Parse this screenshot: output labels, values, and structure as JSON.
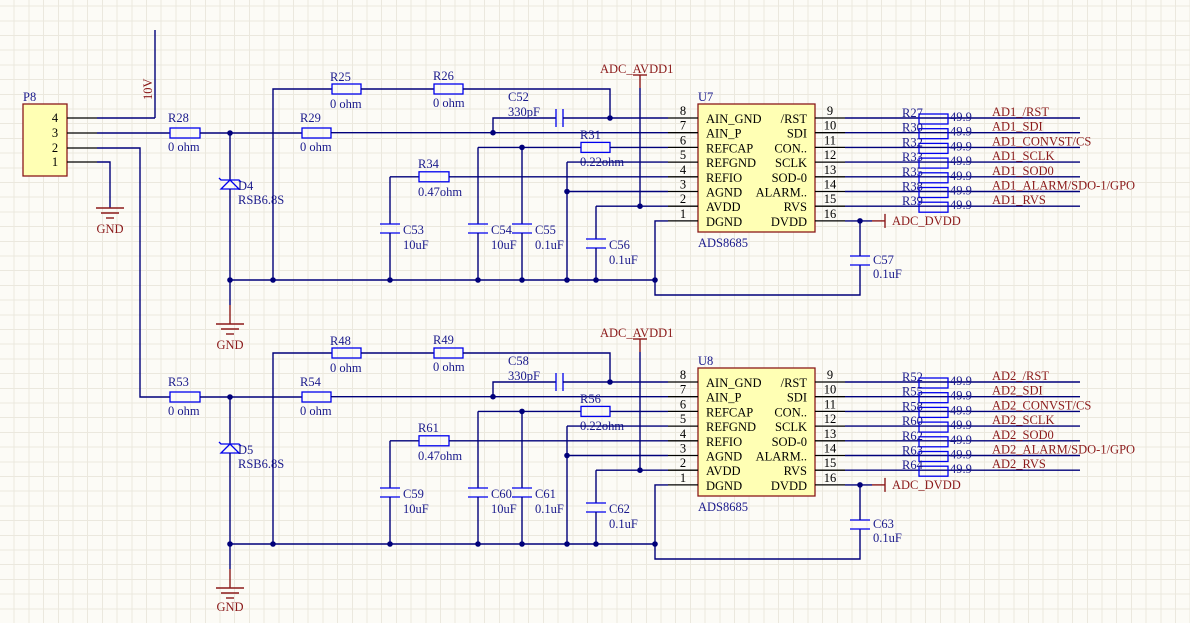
{
  "connector": {
    "ref": "P8",
    "pins": [
      "4",
      "3",
      "2",
      "1"
    ]
  },
  "power": {
    "v10": "10V",
    "gnd": "GND",
    "avdd": "ADC_AVDD1",
    "dvdd": "ADC_DVDD"
  },
  "colors": {
    "wire": "#00007a",
    "component": "#0000ee",
    "net_label": "#8b1a1a",
    "chip_fill": "#ffffb4"
  },
  "channels": [
    {
      "chip": {
        "ref": "U7",
        "part": "ADS8685",
        "left_pins": [
          {
            "num": "8",
            "name": "AIN_GND"
          },
          {
            "num": "7",
            "name": "AIN_P"
          },
          {
            "num": "6",
            "name": "REFCAP"
          },
          {
            "num": "5",
            "name": "REFGND"
          },
          {
            "num": "4",
            "name": "REFIO"
          },
          {
            "num": "3",
            "name": "AGND"
          },
          {
            "num": "2",
            "name": "AVDD"
          },
          {
            "num": "1",
            "name": "DGND"
          }
        ],
        "right_pins": [
          {
            "num": "9",
            "name": "/RST"
          },
          {
            "num": "10",
            "name": "SDI"
          },
          {
            "num": "11",
            "name": "CON.."
          },
          {
            "num": "12",
            "name": "SCLK"
          },
          {
            "num": "13",
            "name": "SOD-0"
          },
          {
            "num": "14",
            "name": "ALARM.."
          },
          {
            "num": "15",
            "name": "RVS"
          },
          {
            "num": "16",
            "name": "DVDD"
          }
        ]
      },
      "r_in": {
        "ref": "R28",
        "value": "0 ohm"
      },
      "diode": {
        "ref": "D4",
        "value": "RSB6.8S"
      },
      "r_loop1": {
        "ref": "R25",
        "value": "0 ohm"
      },
      "r_loop2": {
        "ref": "R26",
        "value": "0 ohm"
      },
      "r_sig": {
        "ref": "R29",
        "value": "0 ohm"
      },
      "c_in": {
        "ref": "C52",
        "value": "330pF"
      },
      "r_refcap": {
        "ref": "R31",
        "value": "0.22ohm"
      },
      "r_refio": {
        "ref": "R34",
        "value": "0.47ohm"
      },
      "c_refio": {
        "ref": "C53",
        "value": "10uF"
      },
      "c_refcap1": {
        "ref": "C54",
        "value": "10uF"
      },
      "c_refcap2": {
        "ref": "C55",
        "value": "0.1uF"
      },
      "c_avdd": {
        "ref": "C56",
        "value": "0.1uF"
      },
      "c_dvdd": {
        "ref": "C57",
        "value": "0.1uF"
      },
      "series": [
        {
          "ref": "R27",
          "value": "49.9",
          "net": "AD1_/RST"
        },
        {
          "ref": "R30",
          "value": "49.9",
          "net": "AD1_SDI"
        },
        {
          "ref": "R32",
          "value": "49.9",
          "net": "AD1_CONVST/CS"
        },
        {
          "ref": "R33",
          "value": "49.9",
          "net": "AD1_SCLK"
        },
        {
          "ref": "R35",
          "value": "49.9",
          "net": "AD1_SOD0"
        },
        {
          "ref": "R38",
          "value": "49.9",
          "net": "AD1_ALARM/SDO-1/GPO"
        },
        {
          "ref": "R39",
          "value": "49.9",
          "net": "AD1_RVS"
        }
      ]
    },
    {
      "chip": {
        "ref": "U8",
        "part": "ADS8685",
        "left_pins": [
          {
            "num": "8",
            "name": "AIN_GND"
          },
          {
            "num": "7",
            "name": "AIN_P"
          },
          {
            "num": "6",
            "name": "REFCAP"
          },
          {
            "num": "5",
            "name": "REFGND"
          },
          {
            "num": "4",
            "name": "REFIO"
          },
          {
            "num": "3",
            "name": "AGND"
          },
          {
            "num": "2",
            "name": "AVDD"
          },
          {
            "num": "1",
            "name": "DGND"
          }
        ],
        "right_pins": [
          {
            "num": "9",
            "name": "/RST"
          },
          {
            "num": "10",
            "name": "SDI"
          },
          {
            "num": "11",
            "name": "CON.."
          },
          {
            "num": "12",
            "name": "SCLK"
          },
          {
            "num": "13",
            "name": "SOD-0"
          },
          {
            "num": "14",
            "name": "ALARM.."
          },
          {
            "num": "15",
            "name": "RVS"
          },
          {
            "num": "16",
            "name": "DVDD"
          }
        ]
      },
      "r_in": {
        "ref": "R53",
        "value": "0 ohm"
      },
      "diode": {
        "ref": "D5",
        "value": "RSB6.8S"
      },
      "r_loop1": {
        "ref": "R48",
        "value": "0 ohm"
      },
      "r_loop2": {
        "ref": "R49",
        "value": "0 ohm"
      },
      "r_sig": {
        "ref": "R54",
        "value": "0 ohm"
      },
      "c_in": {
        "ref": "C58",
        "value": "330pF"
      },
      "r_refcap": {
        "ref": "R56",
        "value": "0.22ohm"
      },
      "r_refio": {
        "ref": "R61",
        "value": "0.47ohm"
      },
      "c_refio": {
        "ref": "C59",
        "value": "10uF"
      },
      "c_refcap1": {
        "ref": "C60",
        "value": "10uF"
      },
      "c_refcap2": {
        "ref": "C61",
        "value": "0.1uF"
      },
      "c_avdd": {
        "ref": "C62",
        "value": "0.1uF"
      },
      "c_dvdd": {
        "ref": "C63",
        "value": "0.1uF"
      },
      "series": [
        {
          "ref": "R52",
          "value": "49.9",
          "net": "AD2_/RST"
        },
        {
          "ref": "R55",
          "value": "49.9",
          "net": "AD2_SDI"
        },
        {
          "ref": "R58",
          "value": "49.9",
          "net": "AD2_CONVST/CS"
        },
        {
          "ref": "R60",
          "value": "49.9",
          "net": "AD2_SCLK"
        },
        {
          "ref": "R62",
          "value": "49.9",
          "net": "AD2_SOD0"
        },
        {
          "ref": "R63",
          "value": "49.9",
          "net": "AD2_ALARM/SDO-1/GPO"
        },
        {
          "ref": "R64",
          "value": "49.9",
          "net": "AD2_RVS"
        }
      ]
    }
  ]
}
